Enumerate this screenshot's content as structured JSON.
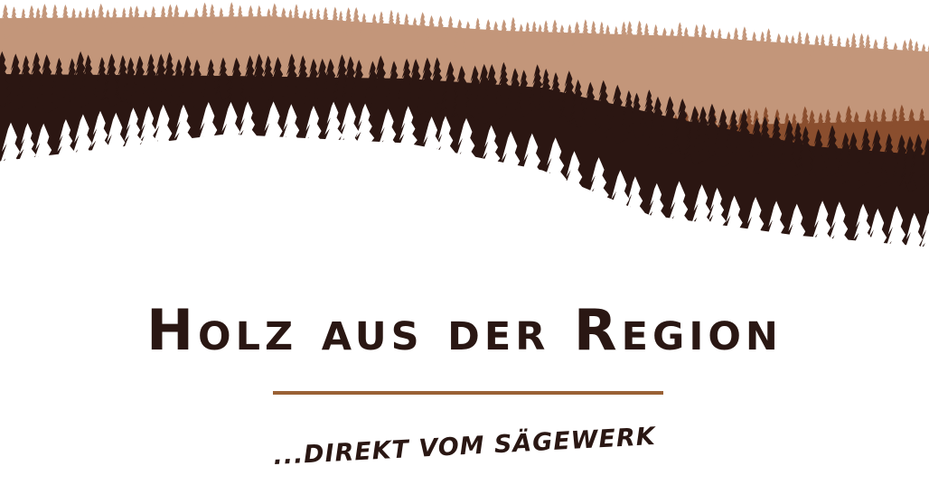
{
  "banner": {
    "icon": "pine-forest-silhouette",
    "colors": {
      "far_trees": "#c3967a",
      "middle_trees": "#8a4e2e",
      "near_trees": "#2b1612",
      "foreground_trees": "#ffffff"
    }
  },
  "headline": {
    "text": "Holz aus der Region",
    "color": "#2a1713"
  },
  "divider": {
    "color": "#9a6135"
  },
  "tagline": {
    "text": "...DIREKT VOM SÄGEWERK",
    "color": "#2a1713"
  }
}
